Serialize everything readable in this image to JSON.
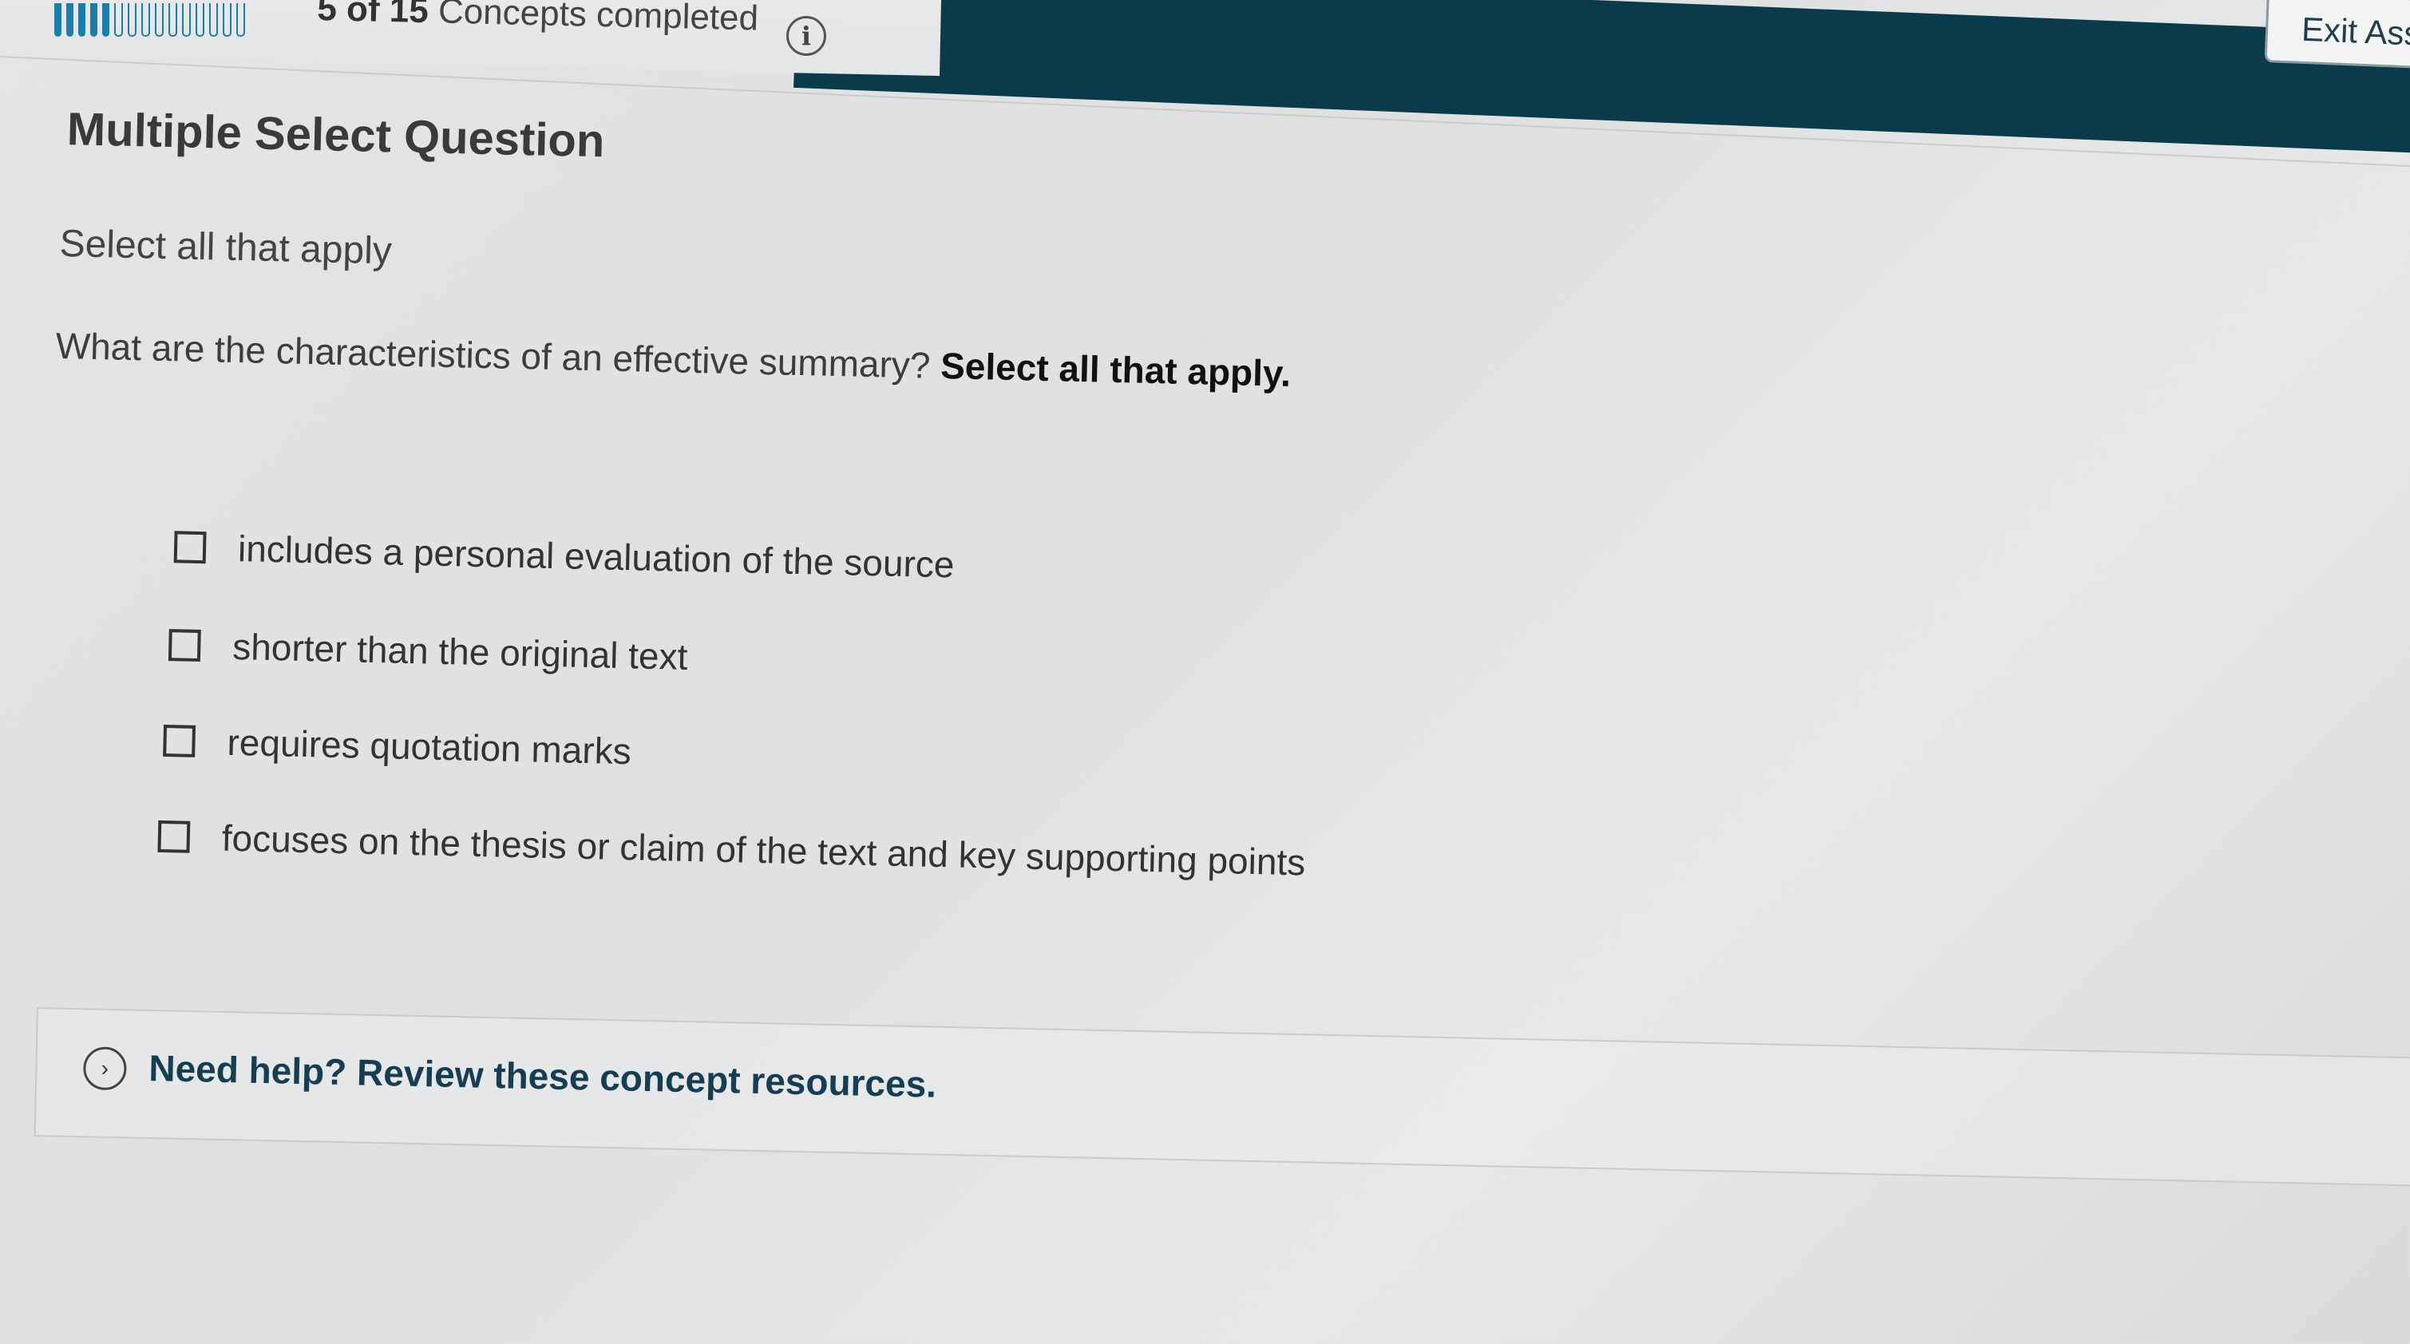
{
  "header": {
    "progress": {
      "completed": 5,
      "total": 15
    },
    "progress_count": "5 of 15",
    "progress_text": "Concepts completed",
    "info_icon": "info-icon",
    "exit_label": "Exit Ass"
  },
  "question": {
    "heading": "Multiple Select Question",
    "instruction": "Select all that apply",
    "prompt": "What are the characteristics of an effective summary?",
    "prompt_emphasis": "Select all that apply.",
    "options": [
      {
        "label": "includes a personal evaluation of the source",
        "checked": false
      },
      {
        "label": "shorter than the original text",
        "checked": false
      },
      {
        "label": "requires quotation marks",
        "checked": false
      },
      {
        "label": "focuses on the thesis or claim of the text and key supporting points",
        "checked": false
      }
    ]
  },
  "help": {
    "icon": "chevron-right-circle-icon",
    "label": "Need help? Review these concept resources."
  },
  "colors": {
    "header_band": "#0b3b4a",
    "progress": "#1a7ea8",
    "help_text": "#163e52"
  }
}
